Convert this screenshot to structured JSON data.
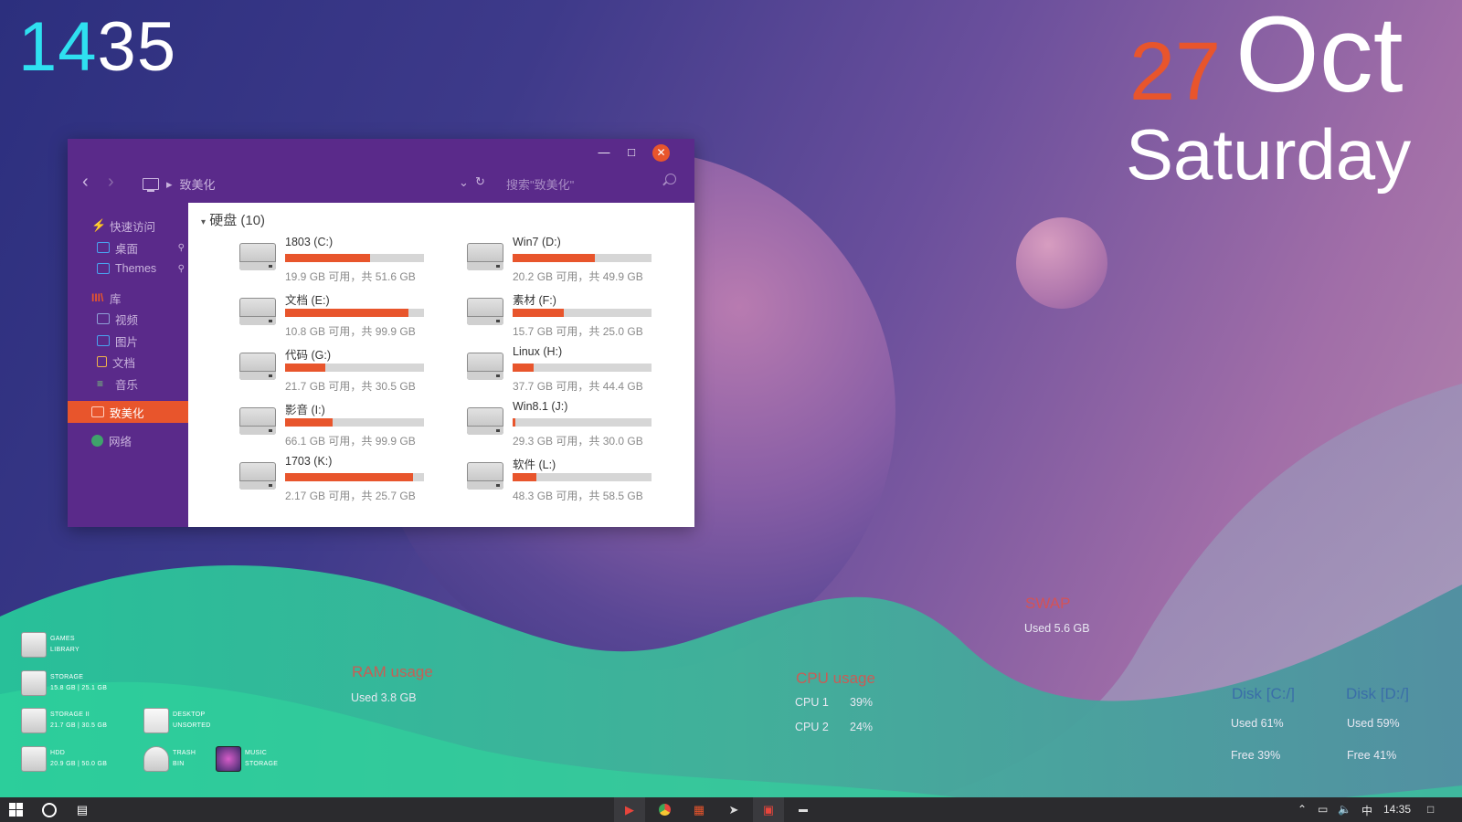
{
  "clock": {
    "hour": "14",
    "minute": "35"
  },
  "date": {
    "day": "27",
    "month": "Oct",
    "weekday": "Saturday"
  },
  "explorer": {
    "breadcrumb": "致美化",
    "search_placeholder": "搜索\"致美化\"",
    "group_title": "硬盘 (10)",
    "sidebar": [
      {
        "label": "快速访问",
        "icon": "lightning-icon"
      },
      {
        "label": "桌面",
        "icon": "desktop-icon"
      },
      {
        "label": "Themes",
        "icon": "folder-icon"
      },
      {
        "label": "库",
        "icon": "library-icon"
      },
      {
        "label": "视频",
        "icon": "video-icon"
      },
      {
        "label": "图片",
        "icon": "picture-icon"
      },
      {
        "label": "文档",
        "icon": "document-icon"
      },
      {
        "label": "音乐",
        "icon": "music-icon"
      },
      {
        "label": "致美化",
        "icon": "computer-icon"
      },
      {
        "label": "网络",
        "icon": "globe-icon"
      }
    ],
    "drives": [
      {
        "name": "1803 (C:)",
        "info": "19.9 GB 可用，共 51.6 GB",
        "used_fraction": 0.61
      },
      {
        "name": "Win7 (D:)",
        "info": "20.2 GB 可用，共 49.9 GB",
        "used_fraction": 0.59
      },
      {
        "name": "文档 (E:)",
        "info": "10.8 GB 可用，共 99.9 GB",
        "used_fraction": 0.89
      },
      {
        "name": "素材 (F:)",
        "info": "15.7 GB 可用，共 25.0 GB",
        "used_fraction": 0.37
      },
      {
        "name": "代码 (G:)",
        "info": "21.7 GB 可用，共 30.5 GB",
        "used_fraction": 0.29
      },
      {
        "name": "Linux (H:)",
        "info": "37.7 GB 可用，共 44.4 GB",
        "used_fraction": 0.15
      },
      {
        "name": "影音 (I:)",
        "info": "66.1 GB 可用，共 99.9 GB",
        "used_fraction": 0.34
      },
      {
        "name": "Win8.1 (J:)",
        "info": "29.3 GB 可用，共 30.0 GB",
        "used_fraction": 0.02
      },
      {
        "name": "1703 (K:)",
        "info": "2.17 GB 可用，共 25.7 GB",
        "used_fraction": 0.92
      },
      {
        "name": "软件 (L:)",
        "info": "48.3 GB 可用，共 58.5 GB",
        "used_fraction": 0.17
      }
    ]
  },
  "desktop_icons": [
    {
      "line1": "Games",
      "line2": "Library",
      "icon": "gamepad-icon"
    },
    {
      "line1": "Storage",
      "line2": "15.8 GB | 25.1 GB",
      "icon": "usb-icon"
    },
    {
      "line1": "Storage II",
      "line2": "21.7 GB | 30.5 GB",
      "icon": "drive-icon"
    },
    {
      "line1": "HDD",
      "line2": "20.9 GB | 50.0 GB",
      "icon": "hdd-icon"
    },
    {
      "line1": "Desktop",
      "line2": "Unsorted",
      "icon": "archive-icon"
    },
    {
      "line1": "Trash",
      "line2": "Bin",
      "icon": "trash-icon"
    },
    {
      "line1": "Music",
      "line2": "Storage",
      "icon": "headphones-icon"
    }
  ],
  "widgets": {
    "ram": {
      "title": "RAM usage",
      "text": "Used 3.8 GB"
    },
    "swap": {
      "title": "SWAP",
      "text": "Used 5.6 GB"
    },
    "cpu": {
      "title": "CPU usage",
      "rows": [
        {
          "label": "CPU 1",
          "value": "39%"
        },
        {
          "label": "CPU 2",
          "value": "24%"
        }
      ]
    },
    "disk_c": {
      "title": "Disk [C:/]",
      "used": "Used 61%",
      "free": "Free 39%"
    },
    "disk_d": {
      "title": "Disk [D:/]",
      "used": "Used 59%",
      "free": "Free 41%"
    }
  },
  "taskbar": {
    "time": "14:35",
    "ime": "中",
    "pinned": [
      "youtube-icon",
      "chrome-icon",
      "apps-icon",
      "rocket-icon",
      "monitor-icon",
      "card-icon"
    ]
  },
  "colors": {
    "accent": "#e8552c",
    "clock_hour": "#2fe0f0",
    "explorer_bg": "#5a2a8a",
    "teal_wave": "#2fd69c"
  }
}
